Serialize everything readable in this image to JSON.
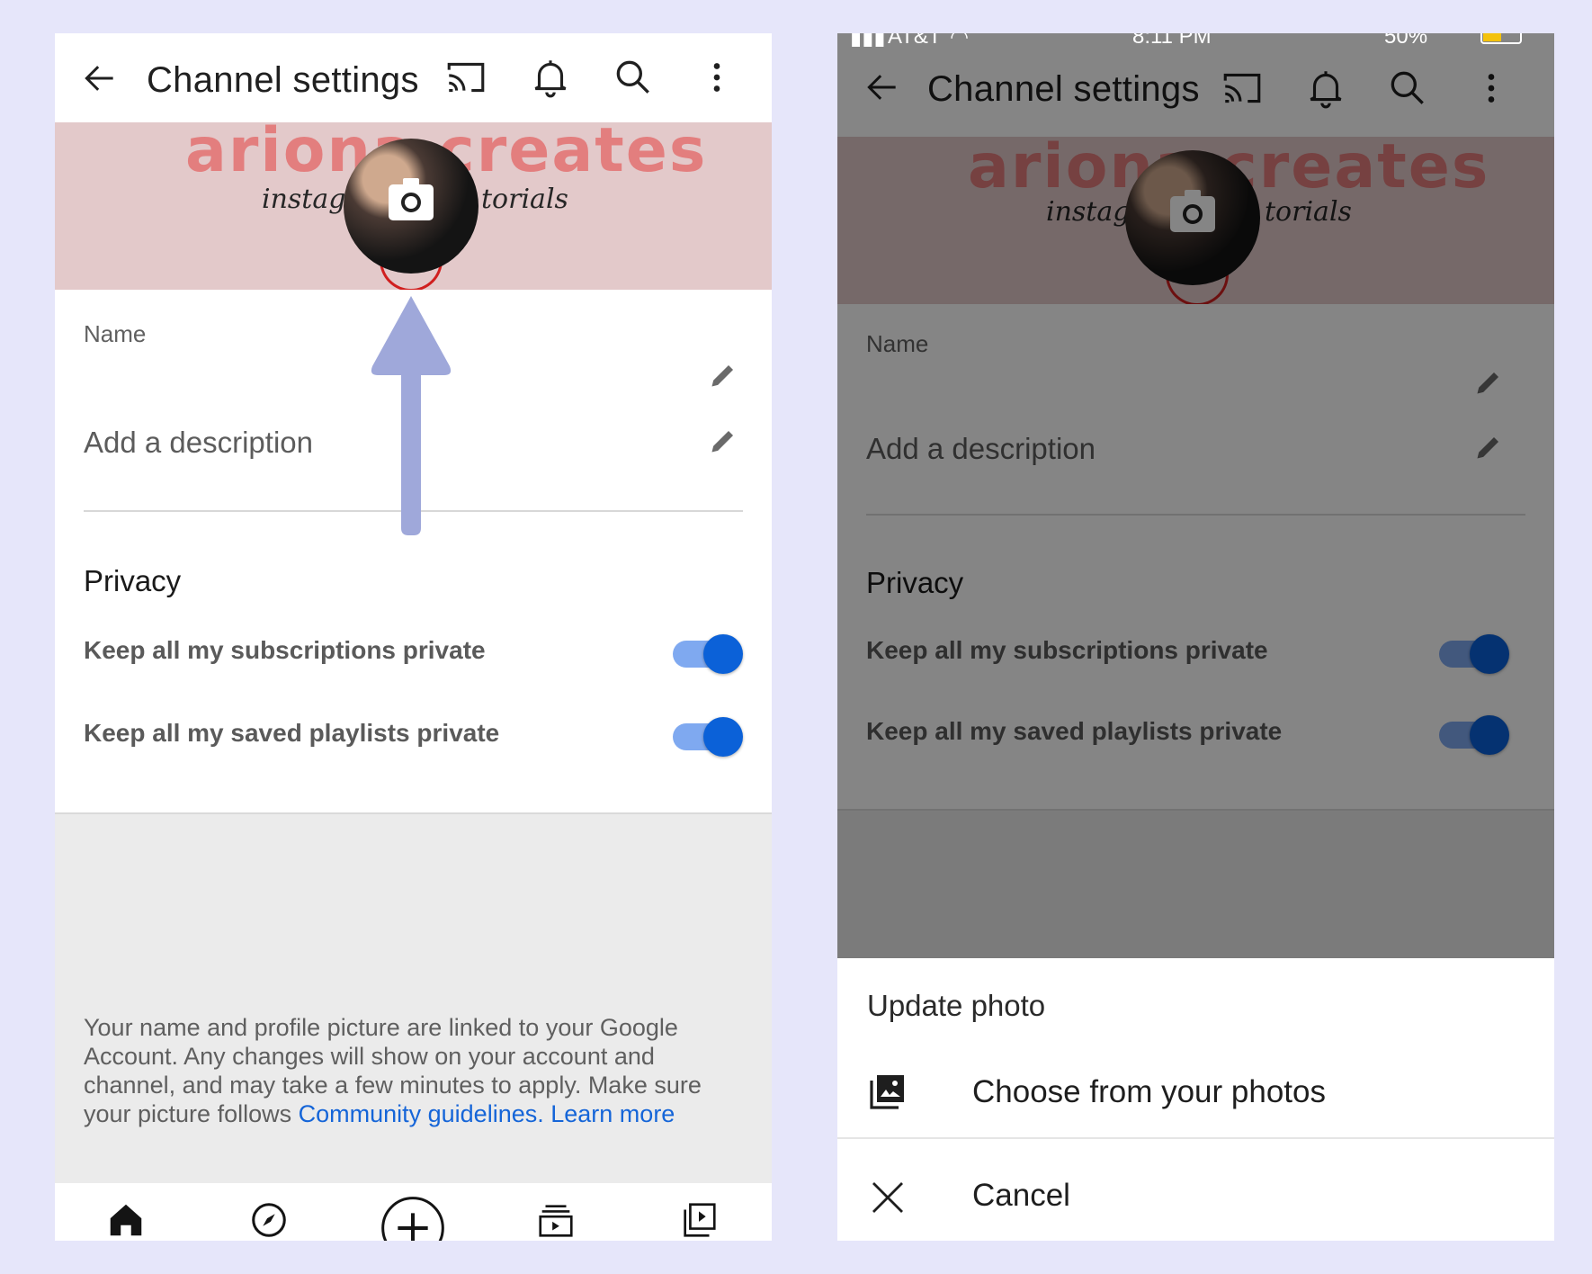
{
  "left_screen": {
    "appbar": {
      "title": "Channel settings",
      "icons": [
        "back-arrow-icon",
        "cast-icon",
        "bell-icon",
        "search-icon",
        "more-vert-icon"
      ]
    },
    "banner": {
      "title": "ariona creates",
      "subtitle_left": "instagr",
      "subtitle_right": "torials"
    },
    "name_label": "Name",
    "description_placeholder": "Add a description",
    "privacy": {
      "heading": "Privacy",
      "toggles": [
        {
          "label": "Keep all my subscriptions private",
          "on": true
        },
        {
          "label": "Keep all my saved playlists private",
          "on": true
        }
      ]
    },
    "footer": {
      "text": "Your name and profile picture are linked to your Google Account. Any changes will show on your account and channel, and may take a few minutes to apply. Make sure your picture follows ",
      "link1": "Community guidelines.",
      "link2": "Learn more"
    },
    "bottom_nav": [
      "home-icon",
      "explore-icon",
      "create-icon",
      "subscriptions-icon",
      "library-icon"
    ]
  },
  "right_screen": {
    "status_bar": {
      "carrier": "AT&T",
      "time": "8:11 PM",
      "battery": "50%"
    },
    "appbar": {
      "title": "Channel settings"
    },
    "banner": {
      "title": "ariona creates",
      "subtitle_left": "instagr",
      "subtitle_right": "torials"
    },
    "name_label": "Name",
    "description_placeholder": "Add a description",
    "privacy": {
      "heading": "Privacy",
      "toggles": [
        {
          "label": "Keep all my subscriptions private",
          "on": true
        },
        {
          "label": "Keep all my saved playlists private",
          "on": true
        }
      ]
    },
    "sheet": {
      "title": "Update photo",
      "options": [
        {
          "label": "Choose from your photos",
          "icon": "photos-icon"
        },
        {
          "label": "Cancel",
          "icon": "close-icon"
        }
      ]
    }
  },
  "colors": {
    "page_bg": "#e6e6fa",
    "toggle_on": "#0b61d8",
    "toggle_track": "#7fa9f0",
    "link": "#1565d8",
    "annotation_arrow": "#9fa8da"
  }
}
